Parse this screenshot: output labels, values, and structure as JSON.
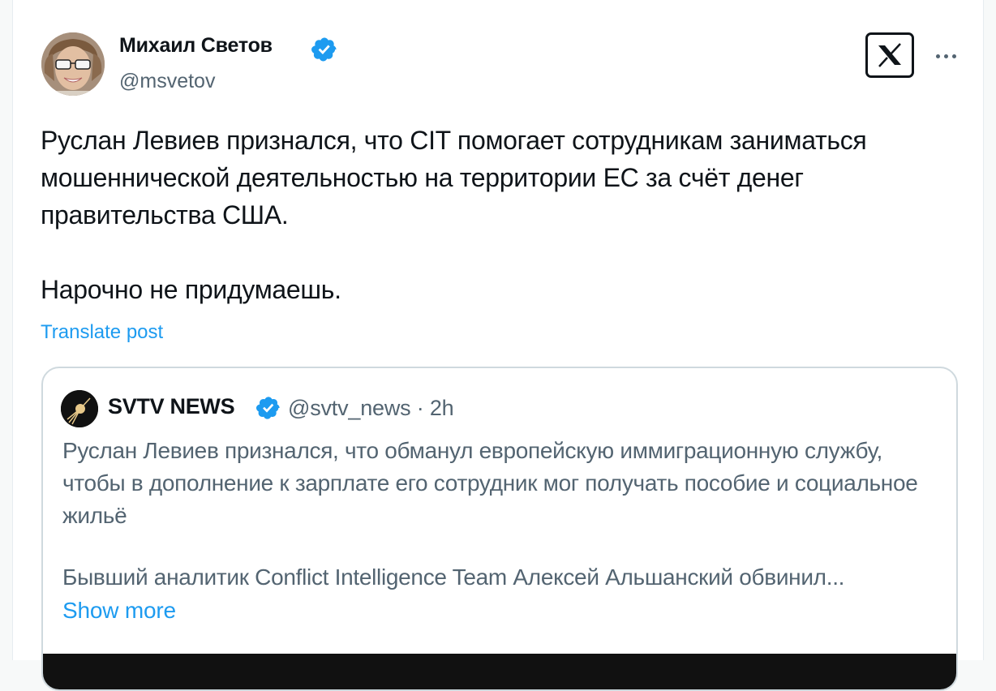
{
  "post": {
    "author_name": "Михаил Светов",
    "author_handle": "@msvetov",
    "text": "Руслан Левиев признался, что CIT помогает сотрудникам заниматься мошеннической деятельностью на территории ЕС за счёт денег правительства США.\n\nНарочно не придумаешь.",
    "translate_label": "Translate post"
  },
  "quoted": {
    "author_name": "SVTV NEWS",
    "meta": "@svtv_news · 2h",
    "text": "Руслан Левиев признался, что обманул европейскую иммиграционную службу, чтобы в дополнение к зарплате его сотрудник мог получать пособие и социальное жильё",
    "truncated_line": "Бывший аналитик Conflict Intelligence Team Алексей Альшанский обвинил...",
    "show_more_label": "Show more"
  },
  "icons": {
    "verified": "verified-badge-icon",
    "more": "more-icon",
    "app_logo": "x-logo-icon"
  },
  "colors": {
    "accent": "#1d9bf0",
    "text_primary": "#0f1419",
    "text_secondary": "#536471",
    "border": "#cfd9de"
  }
}
